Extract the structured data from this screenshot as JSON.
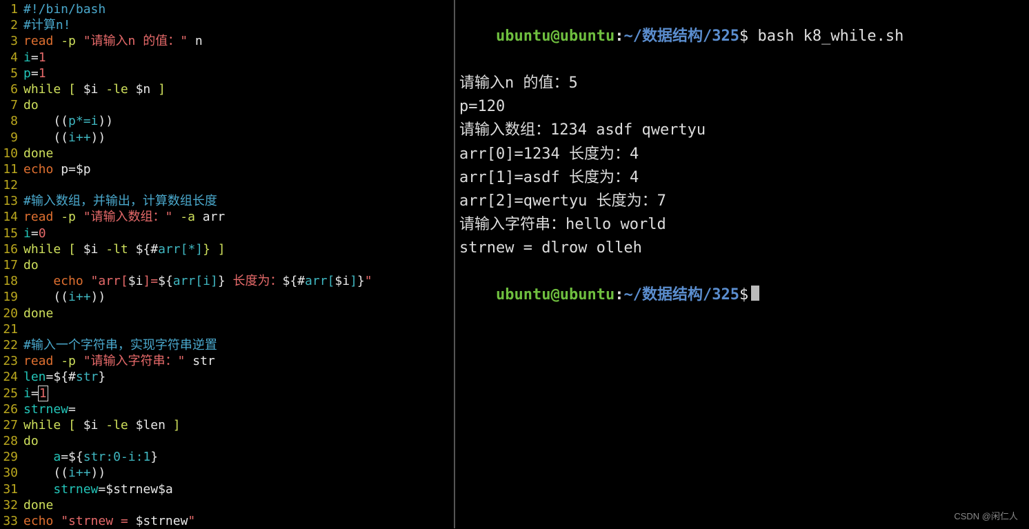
{
  "editor": {
    "lines": [
      {
        "n": 1,
        "spans": [
          {
            "t": "#!/bin/bash",
            "c": "c-blue"
          }
        ]
      },
      {
        "n": 2,
        "spans": [
          {
            "t": "#计算n!",
            "c": "c-blue"
          }
        ]
      },
      {
        "n": 3,
        "spans": [
          {
            "t": "read ",
            "c": "c-orange"
          },
          {
            "t": "-p ",
            "c": "c-yellow"
          },
          {
            "t": "\"请输入n 的值：\"",
            "c": "c-red"
          },
          {
            "t": " n",
            "c": "c-white"
          }
        ]
      },
      {
        "n": 4,
        "spans": [
          {
            "t": "i",
            "c": "c-cyan"
          },
          {
            "t": "=",
            "c": "c-white"
          },
          {
            "t": "1",
            "c": "c-red"
          }
        ]
      },
      {
        "n": 5,
        "spans": [
          {
            "t": "p",
            "c": "c-cyan"
          },
          {
            "t": "=",
            "c": "c-white"
          },
          {
            "t": "1",
            "c": "c-red"
          }
        ]
      },
      {
        "n": 6,
        "spans": [
          {
            "t": "while [ ",
            "c": "c-yellow"
          },
          {
            "t": "$i",
            "c": "c-white"
          },
          {
            "t": " -le ",
            "c": "c-yellow"
          },
          {
            "t": "$n",
            "c": "c-white"
          },
          {
            "t": " ]",
            "c": "c-yellow"
          }
        ]
      },
      {
        "n": 7,
        "spans": [
          {
            "t": "do",
            "c": "c-yellow"
          }
        ]
      },
      {
        "n": 8,
        "spans": [
          {
            "t": "    ((",
            "c": "c-white"
          },
          {
            "t": "p*=i",
            "c": "c-cyan2"
          },
          {
            "t": "))",
            "c": "c-white"
          }
        ]
      },
      {
        "n": 9,
        "spans": [
          {
            "t": "    ((",
            "c": "c-white"
          },
          {
            "t": "i++",
            "c": "c-cyan2"
          },
          {
            "t": "))",
            "c": "c-white"
          }
        ]
      },
      {
        "n": 10,
        "spans": [
          {
            "t": "done",
            "c": "c-yellow"
          }
        ]
      },
      {
        "n": 11,
        "spans": [
          {
            "t": "echo ",
            "c": "c-orange"
          },
          {
            "t": "p",
            "c": "c-white"
          },
          {
            "t": "=",
            "c": "c-white"
          },
          {
            "t": "$p",
            "c": "c-white"
          }
        ]
      },
      {
        "n": 12,
        "spans": [
          {
            "t": "",
            "c": "c-white"
          }
        ]
      },
      {
        "n": 13,
        "spans": [
          {
            "t": "#输入数组，并输出，计算数组长度",
            "c": "c-blue"
          }
        ]
      },
      {
        "n": 14,
        "spans": [
          {
            "t": "read ",
            "c": "c-orange"
          },
          {
            "t": "-p ",
            "c": "c-yellow"
          },
          {
            "t": "\"请输入数组：\"",
            "c": "c-red"
          },
          {
            "t": " -a",
            "c": "c-yellow"
          },
          {
            "t": " arr",
            "c": "c-white"
          }
        ]
      },
      {
        "n": 15,
        "spans": [
          {
            "t": "i",
            "c": "c-cyan"
          },
          {
            "t": "=",
            "c": "c-white"
          },
          {
            "t": "0",
            "c": "c-red"
          }
        ]
      },
      {
        "n": 16,
        "spans": [
          {
            "t": "while [ ",
            "c": "c-yellow"
          },
          {
            "t": "$i",
            "c": "c-white"
          },
          {
            "t": " -lt ",
            "c": "c-yellow"
          },
          {
            "t": "${#",
            "c": "c-white"
          },
          {
            "t": "arr[*]",
            "c": "c-cyan2"
          },
          {
            "t": "} ]",
            "c": "c-yellow"
          }
        ]
      },
      {
        "n": 17,
        "spans": [
          {
            "t": "do",
            "c": "c-yellow"
          }
        ]
      },
      {
        "n": 18,
        "spans": [
          {
            "t": "    echo ",
            "c": "c-orange"
          },
          {
            "t": "\"arr[",
            "c": "c-red"
          },
          {
            "t": "$i",
            "c": "c-white"
          },
          {
            "t": "]=",
            "c": "c-red"
          },
          {
            "t": "${",
            "c": "c-white"
          },
          {
            "t": "arr[i]",
            "c": "c-cyan2"
          },
          {
            "t": "}",
            "c": "c-white"
          },
          {
            "t": " 长度为：",
            "c": "c-red"
          },
          {
            "t": "${#",
            "c": "c-white"
          },
          {
            "t": "arr[",
            "c": "c-cyan2"
          },
          {
            "t": "$i",
            "c": "c-white"
          },
          {
            "t": "]",
            "c": "c-cyan2"
          },
          {
            "t": "}",
            "c": "c-white"
          },
          {
            "t": "\"",
            "c": "c-red"
          }
        ]
      },
      {
        "n": 19,
        "spans": [
          {
            "t": "    ((",
            "c": "c-white"
          },
          {
            "t": "i++",
            "c": "c-cyan2"
          },
          {
            "t": "))",
            "c": "c-white"
          }
        ]
      },
      {
        "n": 20,
        "spans": [
          {
            "t": "done",
            "c": "c-yellow"
          }
        ]
      },
      {
        "n": 21,
        "spans": [
          {
            "t": "",
            "c": "c-white"
          }
        ]
      },
      {
        "n": 22,
        "spans": [
          {
            "t": "#输入一个字符串，实现字符串逆置",
            "c": "c-blue"
          }
        ]
      },
      {
        "n": 23,
        "spans": [
          {
            "t": "read ",
            "c": "c-orange"
          },
          {
            "t": "-p ",
            "c": "c-yellow"
          },
          {
            "t": "\"请输入字符串：\"",
            "c": "c-red"
          },
          {
            "t": " str",
            "c": "c-white"
          }
        ]
      },
      {
        "n": 24,
        "spans": [
          {
            "t": "len",
            "c": "c-cyan"
          },
          {
            "t": "=",
            "c": "c-white"
          },
          {
            "t": "${#",
            "c": "c-white"
          },
          {
            "t": "str",
            "c": "c-cyan2"
          },
          {
            "t": "}",
            "c": "c-white"
          }
        ]
      },
      {
        "n": 25,
        "spans": [
          {
            "t": "i",
            "c": "c-cyan"
          },
          {
            "t": "=",
            "c": "c-white"
          },
          {
            "t": "1",
            "c": "c-red",
            "cursor": true
          }
        ]
      },
      {
        "n": 26,
        "spans": [
          {
            "t": "strnew",
            "c": "c-cyan"
          },
          {
            "t": "=",
            "c": "c-white"
          }
        ]
      },
      {
        "n": 27,
        "spans": [
          {
            "t": "while [ ",
            "c": "c-yellow"
          },
          {
            "t": "$i",
            "c": "c-white"
          },
          {
            "t": " -le ",
            "c": "c-yellow"
          },
          {
            "t": "$len",
            "c": "c-white"
          },
          {
            "t": " ]",
            "c": "c-yellow"
          }
        ]
      },
      {
        "n": 28,
        "spans": [
          {
            "t": "do",
            "c": "c-yellow"
          }
        ]
      },
      {
        "n": 29,
        "spans": [
          {
            "t": "    ",
            "c": "c-white"
          },
          {
            "t": "a",
            "c": "c-cyan"
          },
          {
            "t": "=",
            "c": "c-white"
          },
          {
            "t": "${",
            "c": "c-white"
          },
          {
            "t": "str:0-i:1",
            "c": "c-cyan2"
          },
          {
            "t": "}",
            "c": "c-white"
          }
        ]
      },
      {
        "n": 30,
        "spans": [
          {
            "t": "    ((",
            "c": "c-white"
          },
          {
            "t": "i++",
            "c": "c-cyan2"
          },
          {
            "t": "))",
            "c": "c-white"
          }
        ]
      },
      {
        "n": 31,
        "spans": [
          {
            "t": "    ",
            "c": "c-white"
          },
          {
            "t": "strnew",
            "c": "c-cyan"
          },
          {
            "t": "=",
            "c": "c-white"
          },
          {
            "t": "$strnew$a",
            "c": "c-white"
          }
        ]
      },
      {
        "n": 32,
        "spans": [
          {
            "t": "done",
            "c": "c-yellow"
          }
        ]
      },
      {
        "n": 33,
        "spans": [
          {
            "t": "echo ",
            "c": "c-orange"
          },
          {
            "t": "\"strnew = ",
            "c": "c-red"
          },
          {
            "t": "$strnew",
            "c": "c-white"
          },
          {
            "t": "\"",
            "c": "c-red"
          }
        ]
      }
    ]
  },
  "terminal": {
    "prompt": {
      "user": "ubuntu",
      "at": "@",
      "host": "ubuntu",
      "colon": ":",
      "path1": "~/数据结构",
      "slash": "/",
      "path2": "325",
      "dollar": "$"
    },
    "cmd1": "bash k8_while.sh",
    "out": [
      "请输入n 的值：5",
      "p=120",
      "请输入数组：1234 asdf qwertyu",
      "arr[0]=1234 长度为：4",
      "arr[1]=asdf 长度为：4",
      "arr[2]=qwertyu 长度为：7",
      "请输入字符串：hello world",
      "strnew = dlrow olleh"
    ]
  },
  "watermark": "CSDN @闲仁人"
}
